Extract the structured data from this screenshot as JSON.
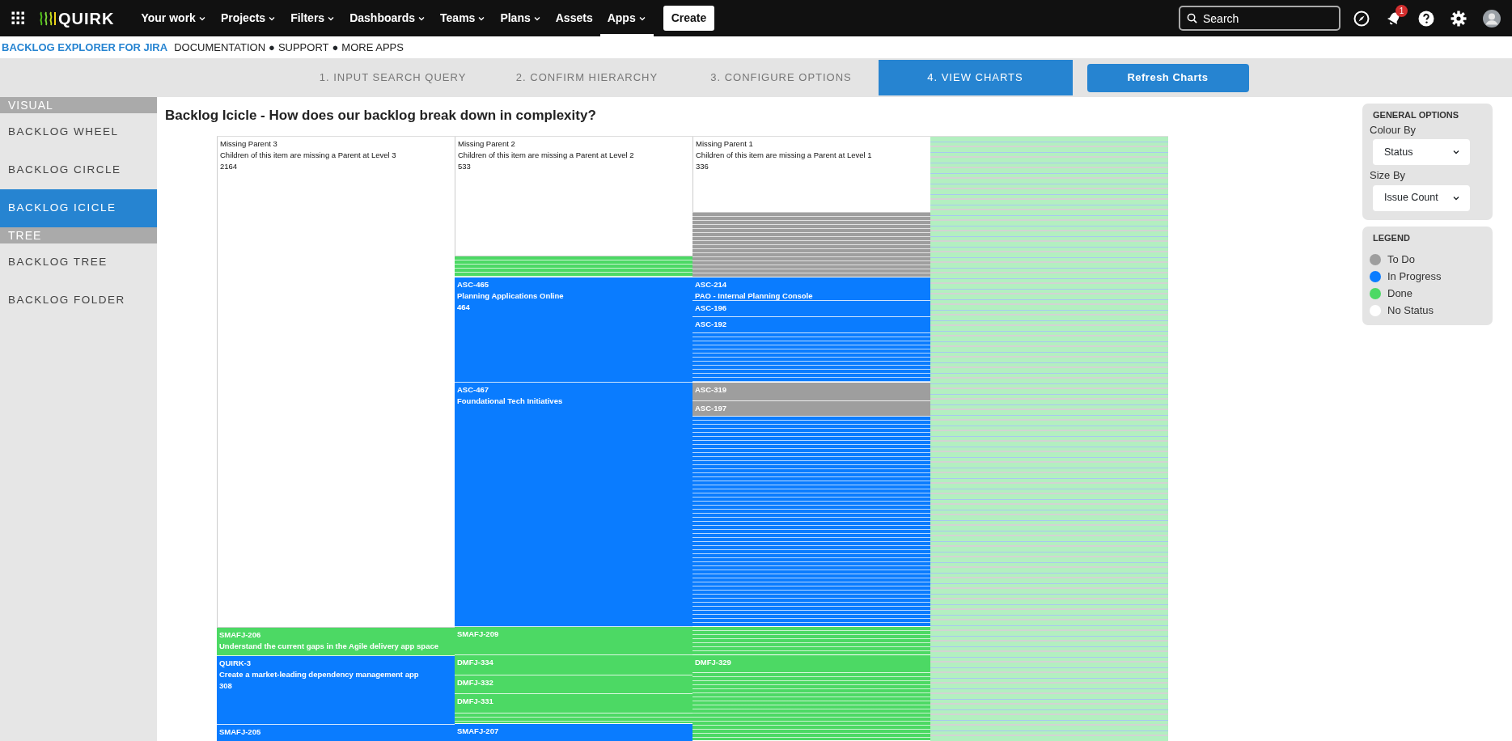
{
  "topnav": {
    "brand": "QUIRK",
    "items": [
      {
        "label": "Your work",
        "dropdown": true,
        "selected": false
      },
      {
        "label": "Projects",
        "dropdown": true,
        "selected": false
      },
      {
        "label": "Filters",
        "dropdown": true,
        "selected": false
      },
      {
        "label": "Dashboards",
        "dropdown": true,
        "selected": false
      },
      {
        "label": "Teams",
        "dropdown": true,
        "selected": false
      },
      {
        "label": "Plans",
        "dropdown": true,
        "selected": false
      },
      {
        "label": "Assets",
        "dropdown": false,
        "selected": false
      },
      {
        "label": "Apps",
        "dropdown": true,
        "selected": true
      }
    ],
    "create": "Create",
    "search": {
      "placeholder": "Search"
    },
    "notification_count": "1"
  },
  "app_header": {
    "title": "BACKLOG EXPLORER FOR JIRA",
    "links": [
      "DOCUMENTATION",
      "SUPPORT",
      "MORE APPS"
    ],
    "separator": "●"
  },
  "steps": [
    {
      "label": "1. INPUT SEARCH QUERY",
      "selected": false
    },
    {
      "label": "2. CONFIRM HIERARCHY",
      "selected": false
    },
    {
      "label": "3. CONFIGURE OPTIONS",
      "selected": false
    },
    {
      "label": "4. VIEW CHARTS",
      "selected": true
    }
  ],
  "refresh_button": "Refresh Charts",
  "sidebar": [
    {
      "heading": "VISUAL",
      "items": [
        {
          "label": "BACKLOG WHEEL",
          "selected": false
        },
        {
          "label": "BACKLOG CIRCLE",
          "selected": false
        },
        {
          "label": "BACKLOG ICICLE",
          "selected": true
        }
      ]
    },
    {
      "heading": "TREE",
      "items": [
        {
          "label": "BACKLOG TREE",
          "selected": false
        },
        {
          "label": "BACKLOG FOLDER",
          "selected": false
        }
      ]
    }
  ],
  "chart_title": "Backlog Icicle - How does our backlog break down in complexity?",
  "icicle": {
    "columns": [
      {
        "nodes": [
          {
            "kind": "node",
            "color": "#ffffff",
            "lines": [
              "Missing Parent 3",
              "Children of this item are missing a Parent at Level 3",
              "2164"
            ]
          },
          {
            "kind": "node",
            "color": "#4cd964",
            "lines": [
              "SMAFJ-206",
              "Understand the current gaps in the Agile delivery app space"
            ]
          },
          {
            "kind": "node",
            "color": "#0a7cff",
            "lines": [
              "QUIRK-3",
              "Create a market-leading dependency management app",
              "308"
            ]
          },
          {
            "kind": "node",
            "color": "#0a7cff",
            "lines": [
              "SMAFJ-205"
            ]
          }
        ]
      },
      {
        "nodes": [
          {
            "kind": "node",
            "color": "#ffffff",
            "lines": [
              "Missing Parent 2",
              "Children of this item are missing a Parent at Level 2",
              "533"
            ]
          },
          {
            "kind": "stripes",
            "color": "#4cd964"
          },
          {
            "kind": "node",
            "color": "#0a7cff",
            "lines": [
              "ASC-465",
              "Planning Applications Online",
              "464"
            ]
          },
          {
            "kind": "node",
            "color": "#0a7cff",
            "lines": [
              "ASC-467",
              "Foundational Tech Initiatives"
            ]
          },
          {
            "kind": "node",
            "color": "#4cd964",
            "lines": [
              "SMAFJ-209"
            ]
          },
          {
            "kind": "node",
            "color": "#4cd964",
            "lines": [
              "DMFJ-334"
            ]
          },
          {
            "kind": "node",
            "color": "#4cd964",
            "lines": [
              "DMFJ-332"
            ]
          },
          {
            "kind": "node",
            "color": "#4cd964",
            "lines": [
              "DMFJ-331"
            ]
          },
          {
            "kind": "stripes",
            "color": "#4cd964"
          },
          {
            "kind": "node",
            "color": "#0a7cff",
            "lines": [
              "SMAFJ-207"
            ]
          }
        ]
      },
      {
        "nodes": [
          {
            "kind": "node",
            "color": "#ffffff",
            "lines": [
              "Missing Parent 1",
              "Children of this item are missing a Parent at Level 1",
              "336"
            ]
          },
          {
            "kind": "stripes",
            "color": "#9e9e9e"
          },
          {
            "kind": "node",
            "color": "#0a7cff",
            "lines": [
              "ASC-214",
              "PAO - Internal Planning Console"
            ]
          },
          {
            "kind": "node",
            "color": "#0a7cff",
            "lines": [
              "ASC-196"
            ]
          },
          {
            "kind": "node",
            "color": "#0a7cff",
            "lines": [
              "ASC-192"
            ]
          },
          {
            "kind": "stripes",
            "color": "#0a7cff"
          },
          {
            "kind": "node",
            "color": "#9e9e9e",
            "lines": [
              "ASC-319"
            ]
          },
          {
            "kind": "node",
            "color": "#9e9e9e",
            "lines": [
              "ASC-197"
            ]
          },
          {
            "kind": "stripes",
            "color": "#0a7cff"
          },
          {
            "kind": "stripes",
            "color": "#4cd964"
          },
          {
            "kind": "node",
            "color": "#4cd964",
            "lines": [
              "DMFJ-329"
            ]
          },
          {
            "kind": "stripes",
            "color": "#4cd964"
          }
        ]
      },
      {
        "nodes": [
          {
            "kind": "stripes",
            "color": "#b3efc0"
          }
        ]
      }
    ]
  },
  "general_options": {
    "heading": "GENERAL OPTIONS",
    "fields": [
      {
        "label": "Colour By",
        "value": "Status"
      },
      {
        "label": "Size By",
        "value": "Issue Count"
      }
    ]
  },
  "legend": {
    "heading": "LEGEND",
    "items": [
      {
        "label": "To Do",
        "color": "#9e9e9e"
      },
      {
        "label": "In Progress",
        "color": "#0a7cff"
      },
      {
        "label": "Done",
        "color": "#4cd964"
      },
      {
        "label": "No Status",
        "color": "#ffffff"
      }
    ]
  }
}
